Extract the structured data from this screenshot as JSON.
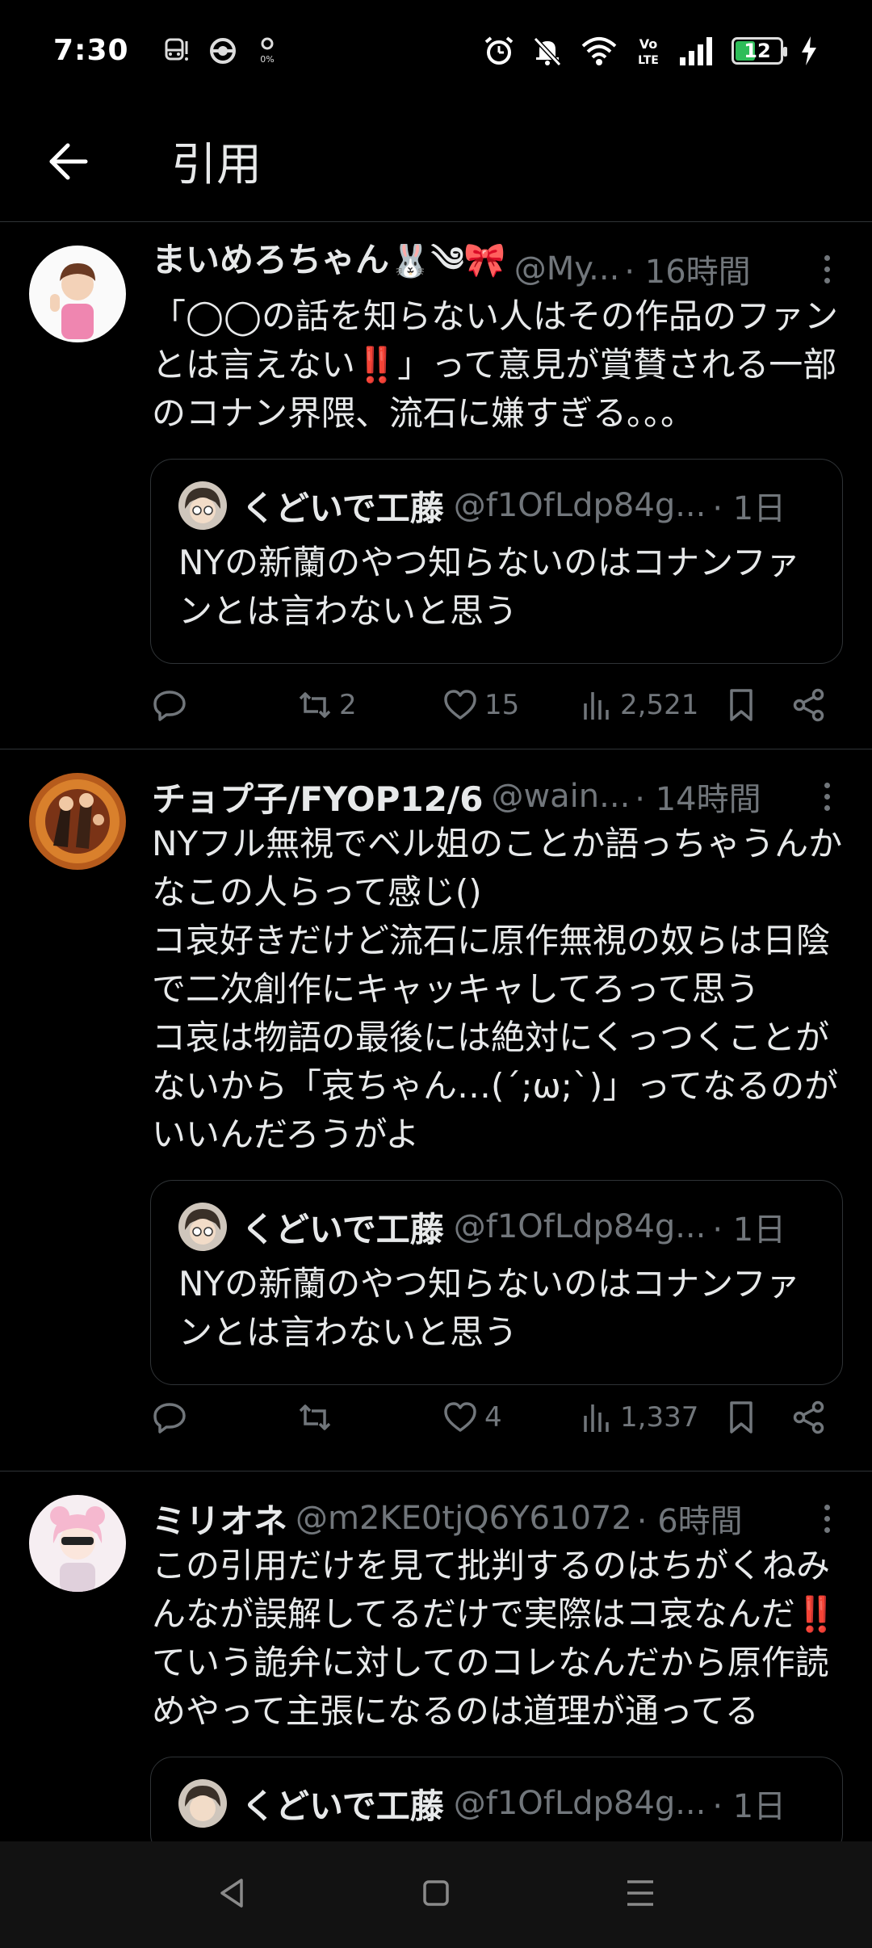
{
  "status_bar": {
    "time": "7:30",
    "battery": "12",
    "left_icons": [
      "train-notification-icon",
      "sync-icon",
      "data-saver-icon"
    ],
    "right_icons": [
      "alarm-icon",
      "mute-icon",
      "wifi-icon",
      "volte-icon",
      "signal-icon",
      "battery-icon",
      "charging-icon"
    ]
  },
  "header": {
    "title": "引用"
  },
  "tweets": [
    {
      "name": "まいめろちゃん🐰༄🎀",
      "handle": "@My...",
      "time": "· 16時間",
      "text": "「◯◯の話を知らない人はその作品のファンとは言えない‼️」って意見が賞賛される一部のコナン界隈、流石に嫌すぎる。。。",
      "quote": {
        "name": "くどいで工藤",
        "handle": "@f1OfLdp84g...",
        "time": "· 1日",
        "text": "NYの新蘭のやつ知らないのはコナンファンとは言わないと思う"
      },
      "stats": {
        "retweets": "2",
        "likes": "15",
        "views": "2,521"
      }
    },
    {
      "name": "チョプ子/FYOP12/6",
      "handle": "@wain...",
      "time": "· 14時間",
      "text": "NYフル無視でベル姐のことか語っちゃうんかなこの人らって感じ()\nコ哀好きだけど流石に原作無視の奴らは日陰で二次創作にキャッキャしてろって思う\nコ哀は物語の最後には絶対にくっつくことがないから「哀ちゃん…(´;ω;`)」ってなるのがいいんだろうがよ",
      "quote": {
        "name": "くどいで工藤",
        "handle": "@f1OfLdp84g...",
        "time": "· 1日",
        "text": "NYの新蘭のやつ知らないのはコナンファンとは言わないと思う"
      },
      "stats": {
        "retweets": "",
        "likes": "4",
        "views": "1,337"
      }
    },
    {
      "name": "ミリオネ",
      "handle": "@m2KE0tjQ6Y61072",
      "time": "· 6時間",
      "text": "この引用だけを見て批判するのはちがくねみんなが誤解してるだけで実際はコ哀なんだ‼️ていう詭弁に対してのコレなんだから原作読めやって主張になるのは道理が通ってる",
      "quote": {
        "name": "くどいで工藤",
        "handle": "@f1OfLdp84g...",
        "time": "· 1日"
      }
    }
  ],
  "nav_bar": {
    "icons": [
      "back-triangle-icon",
      "home-square-icon",
      "recents-menu-icon"
    ]
  },
  "colors": {
    "background": "#000000",
    "text": "#e7e9ea",
    "secondary": "#71767b",
    "divider": "#2f3336",
    "battery_fill": "#2ebd59"
  }
}
